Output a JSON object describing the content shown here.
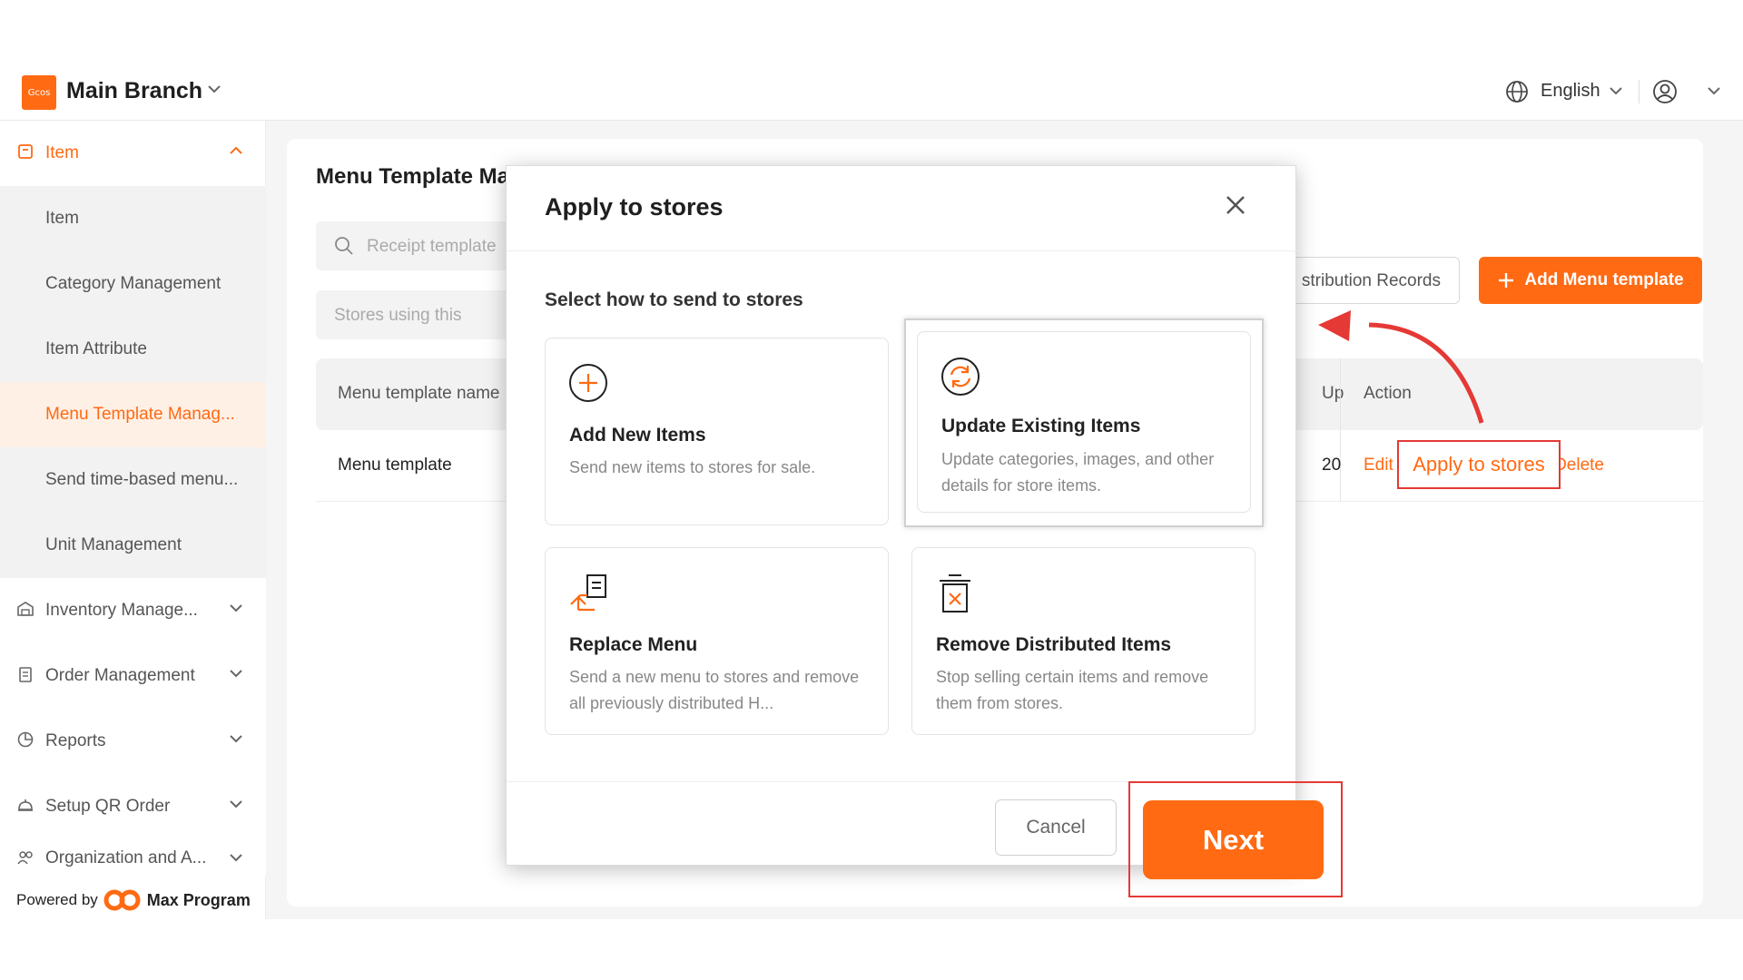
{
  "header": {
    "logo_text": "Gcos",
    "branch": "Main Branch",
    "language": "English"
  },
  "sidebar": {
    "items": [
      {
        "label": "Item",
        "kind": "parent"
      },
      {
        "label": "Item",
        "kind": "sub"
      },
      {
        "label": "Category Management",
        "kind": "sub"
      },
      {
        "label": "Item Attribute",
        "kind": "sub"
      },
      {
        "label": "Menu Template Manag...",
        "kind": "active"
      },
      {
        "label": "Send time-based menu...",
        "kind": "sub"
      },
      {
        "label": "Unit Management",
        "kind": "sub"
      },
      {
        "label": "Inventory Manage...",
        "kind": "section"
      },
      {
        "label": "Order Management",
        "kind": "section"
      },
      {
        "label": "Reports",
        "kind": "section"
      },
      {
        "label": "Setup QR Order",
        "kind": "section"
      },
      {
        "label": "Organization and A...",
        "kind": "section"
      }
    ],
    "powered_by": "Powered by",
    "brand": "Max Program"
  },
  "page": {
    "title": "Menu Template Ma",
    "search_placeholder": "Receipt template",
    "filter_placeholder": "Stores using this",
    "distribution_button": "stribution Records",
    "add_button": "Add Menu template",
    "table": {
      "col_name": "Menu template name",
      "col_updated": "Up",
      "col_action": "Action",
      "row": {
        "name": "Menu template",
        "updated": "20",
        "edit": "Edit",
        "apply": "Apply to stores",
        "delete": "Delete"
      }
    }
  },
  "modal": {
    "title": "Apply to stores",
    "subtitle": "Select how to send to stores",
    "options": [
      {
        "title": "Add New Items",
        "desc": "Send new items to stores for sale."
      },
      {
        "title": "Update Existing Items",
        "desc": "Update categories, images, and other details for store items."
      },
      {
        "title": "Replace Menu",
        "desc": "Send a new menu to stores and remove all previously distributed H..."
      },
      {
        "title": "Remove Distributed Items",
        "desc": "Stop selling certain items and remove them from stores."
      }
    ],
    "cancel": "Cancel",
    "next": "Next"
  },
  "colors": {
    "accent": "#ff6a13",
    "highlight_border": "#e53935"
  }
}
